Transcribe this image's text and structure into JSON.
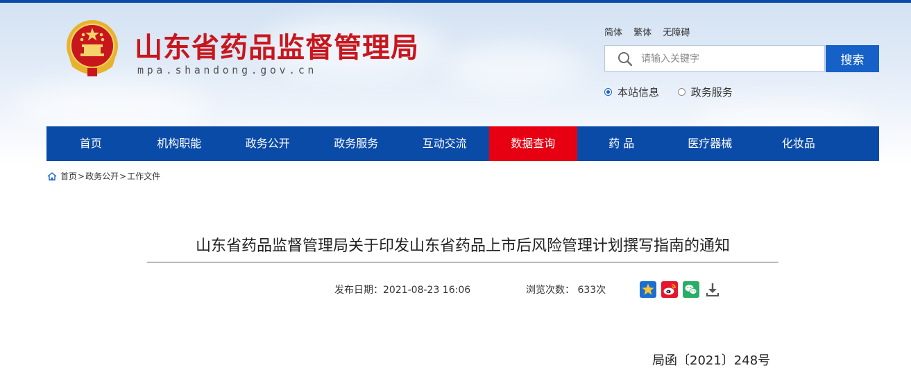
{
  "site": {
    "title": "山东省药品监督管理局",
    "domain": "mpa.shandong.gov.cn"
  },
  "language": {
    "simplified": "简体",
    "traditional": "繁体",
    "accessibility": "无障碍"
  },
  "search": {
    "placeholder": "请输入关键字",
    "button_label": "搜索",
    "scopes": [
      {
        "label": "本站信息",
        "selected": true
      },
      {
        "label": "政务服务",
        "selected": false
      }
    ]
  },
  "nav": {
    "items": [
      {
        "label": "首页"
      },
      {
        "label": "机构职能"
      },
      {
        "label": "政务公开"
      },
      {
        "label": "政务服务"
      },
      {
        "label": "互动交流"
      },
      {
        "label": "数据查询",
        "active": true
      },
      {
        "label": "药 品"
      },
      {
        "label": "医疗器械"
      },
      {
        "label": "化妆品"
      }
    ]
  },
  "breadcrumb": {
    "items": [
      "首页",
      "政务公开",
      "工作文件"
    ],
    "separator": ">"
  },
  "article": {
    "title": "山东省药品监督管理局关于印发山东省药品上市后风险管理计划撰写指南的通知",
    "publish_label": "发布日期：",
    "publish_date": "2021-08-23 16:06",
    "views_label": "浏览次数：",
    "views_count": "633次",
    "doc_number": "局函〔2021〕248号"
  },
  "share_icons": [
    "favorite-star-icon",
    "weibo-icon",
    "wechat-icon",
    "download-icon"
  ],
  "colors": {
    "brand_blue": "#0a4ba8",
    "nav_active_red": "#e60012",
    "title_red": "#c8161d",
    "button_blue": "#1661c7"
  }
}
